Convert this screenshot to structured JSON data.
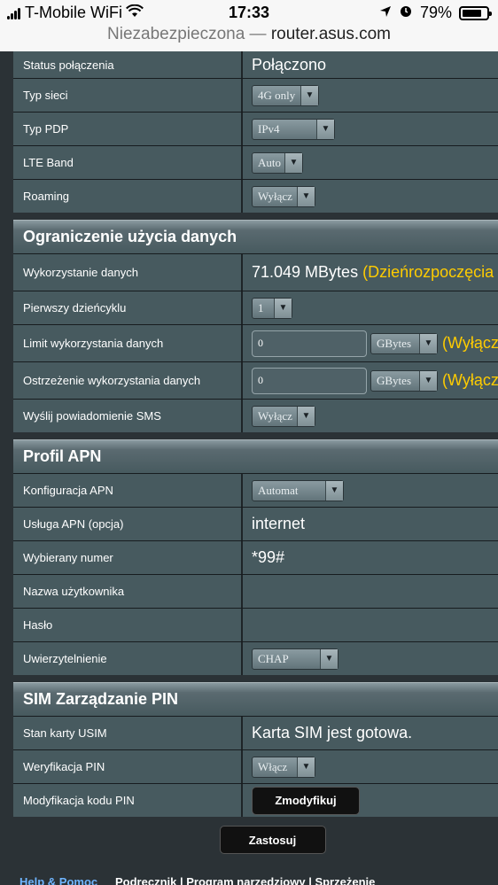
{
  "statusbar": {
    "carrier": "T-Mobile WiFi",
    "time": "17:33",
    "battery": "79%",
    "battery_level": 0.79
  },
  "addressbar": {
    "security": "Niezabezpieczona",
    "separator": "—",
    "host": "router.asus.com"
  },
  "connection": {
    "status_label": "Status połączenia",
    "status_value": "Połączono",
    "network_type_label": "Typ sieci",
    "network_type_value": "4G only",
    "pdp_label": "Typ PDP",
    "pdp_value": "IPv4",
    "lte_label": "LTE Band",
    "lte_value": "Auto",
    "roaming_label": "Roaming",
    "roaming_value": "Wyłącz"
  },
  "data_limit": {
    "title": "Ograniczenie użycia danych",
    "usage_label": "Wykorzystanie danych",
    "usage_value": "71.049 MBytes",
    "usage_note": "(Dzieńrozpoczęcia :",
    "first_day_label": "Pierwszy dzieńcyklu",
    "first_day_value": "1",
    "limit_label": "Limit wykorzystania danych",
    "limit_value": "0",
    "limit_unit": "GBytes",
    "limit_note": "(Wyłącz",
    "warning_label": "Ostrzeżenie wykorzystania danych",
    "warning_value": "0",
    "warning_unit": "GBytes",
    "warning_note": "(Wyłącz",
    "sms_label": "Wyślij powiadomienie SMS",
    "sms_value": "Wyłącz"
  },
  "apn": {
    "title": "Profil APN",
    "config_label": "Konfiguracja APN",
    "config_value": "Automat",
    "service_label": "Usługa APN (opcja)",
    "service_value": "internet",
    "dial_label": "Wybierany numer",
    "dial_value": "*99#",
    "username_label": "Nazwa użytkownika",
    "username_value": "",
    "password_label": "Hasło",
    "password_value": "",
    "auth_label": "Uwierzytelnienie",
    "auth_value": "CHAP"
  },
  "sim": {
    "title": "SIM Zarządzanie PIN",
    "usim_label": "Stan karty USIM",
    "usim_value": "Karta SIM jest gotowa.",
    "pin_verify_label": "Weryfikacja PIN",
    "pin_verify_value": "Włącz",
    "pin_modify_label": "Modyfikacja kodu PIN",
    "pin_modify_button": "Zmodyfikuj"
  },
  "apply_button": "Zastosuj",
  "footer": {
    "help": "Help & Pomoc",
    "links": "Podręcznik | Program narzędziowy | Sprzężenie"
  }
}
